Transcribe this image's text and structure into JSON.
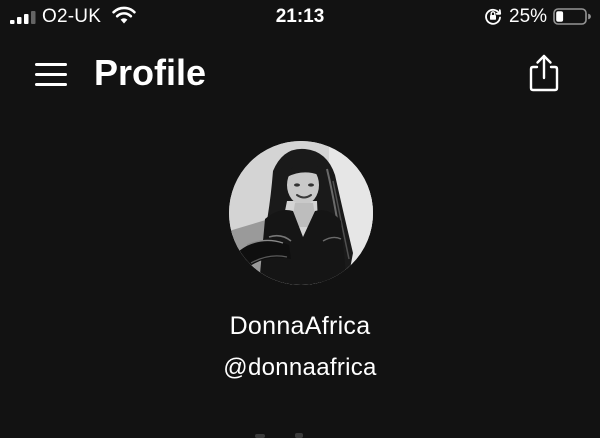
{
  "status_bar": {
    "carrier": "O2-UK",
    "time": "21:13",
    "battery_percent": "25%",
    "battery_level": 0.25,
    "signal_bars": 3,
    "signal_bars_total": 4,
    "icons": [
      "signal-icon",
      "wifi-icon",
      "rotation-lock-icon",
      "battery-icon"
    ]
  },
  "header": {
    "title": "Profile",
    "icons": [
      "hamburger-menu-icon",
      "share-icon"
    ]
  },
  "profile": {
    "display_name": "DonnaAfrica",
    "handle": "@donnaafrica",
    "avatar": "profile-photo"
  },
  "colors": {
    "background": "#121212",
    "text": "#ffffff"
  }
}
